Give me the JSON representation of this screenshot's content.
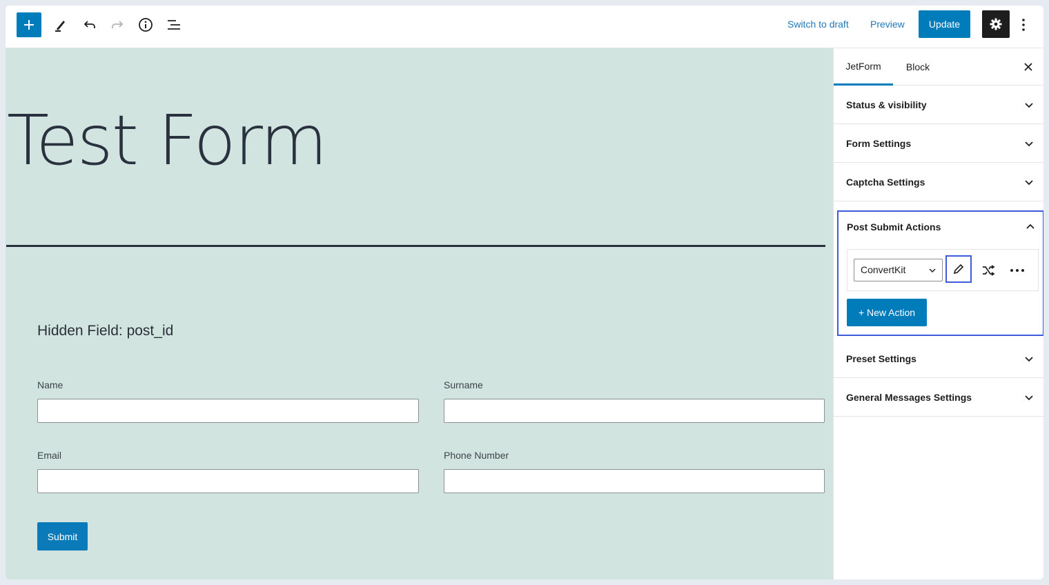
{
  "toolbar": {
    "switch_to_draft": "Switch to draft",
    "preview": "Preview",
    "update": "Update",
    "icons": [
      "plus-icon",
      "pencil-icon",
      "undo-icon",
      "redo-icon",
      "info-icon",
      "list-view-icon",
      "gear-icon",
      "kebab-menu-icon"
    ]
  },
  "canvas": {
    "title": "Test Form",
    "hidden_field": "Hidden Field: post_id",
    "fields": {
      "name": "Name",
      "surname": "Surname",
      "email": "Email",
      "phone": "Phone Number"
    },
    "submit": "Submit",
    "background": "#d2e4df"
  },
  "sidebar": {
    "tabs": [
      "JetForm",
      "Block"
    ],
    "panels": {
      "status": "Status & visibility",
      "form_settings": "Form Settings",
      "captcha": "Captcha Settings",
      "post_submit": "Post Submit Actions",
      "preset": "Preset Settings",
      "messages": "General Messages Settings"
    },
    "action_select": "ConvertKit",
    "new_action": "+ New Action"
  },
  "colors": {
    "accent": "#007cba",
    "highlight": "#3b5bdb"
  }
}
